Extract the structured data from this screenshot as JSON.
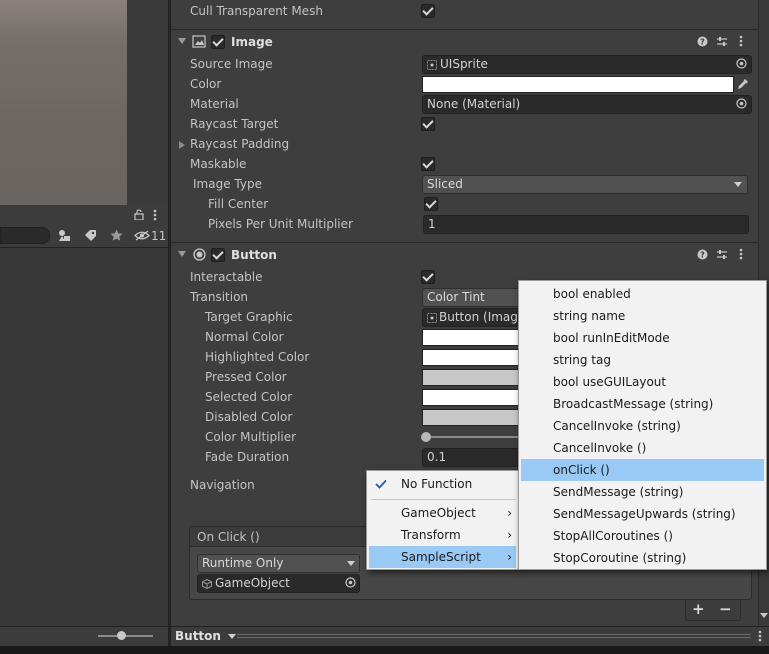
{
  "hierarchy": {
    "layer_count": "11"
  },
  "inspector": {
    "cull_transparent_mesh_label": "Cull Transparent Mesh",
    "image": {
      "title": "Image",
      "fields": {
        "source_image_label": "Source Image",
        "source_image_value": "UISprite",
        "color_label": "Color",
        "material_label": "Material",
        "material_value": "None (Material)",
        "raycast_target_label": "Raycast Target",
        "raycast_padding_label": "Raycast Padding",
        "maskable_label": "Maskable",
        "image_type_label": "Image Type",
        "image_type_value": "Sliced",
        "fill_center_label": "Fill Center",
        "ppu_label": "Pixels Per Unit Multiplier",
        "ppu_value": "1"
      }
    },
    "button": {
      "title": "Button",
      "fields": {
        "interactable_label": "Interactable",
        "transition_label": "Transition",
        "transition_value": "Color Tint",
        "target_graphic_label": "Target Graphic",
        "target_graphic_value": "Button (Image)",
        "normal_color_label": "Normal Color",
        "highlighted_color_label": "Highlighted Color",
        "pressed_color_label": "Pressed Color",
        "selected_color_label": "Selected Color",
        "disabled_color_label": "Disabled Color",
        "color_multiplier_label": "Color Multiplier",
        "fade_duration_label": "Fade Duration",
        "fade_duration_value": "0.1",
        "navigation_label": "Navigation"
      },
      "onclick": {
        "header": "On Click ()",
        "runtime_value": "Runtime Only",
        "object_value": "GameObject"
      }
    },
    "footer": {
      "add_label": "+",
      "remove_label": "−",
      "bottom_dropdown": "Button"
    }
  },
  "function_menu": {
    "items": [
      "No Function",
      "GameObject",
      "Transform",
      "SampleScript"
    ],
    "checked": "No Function",
    "highlighted": "SampleScript"
  },
  "method_menu": {
    "items": [
      "bool enabled",
      "string name",
      "bool runInEditMode",
      "string tag",
      "bool useGUILayout",
      "BroadcastMessage (string)",
      "CancelInvoke (string)",
      "CancelInvoke ()",
      "onClick ()",
      "SendMessage (string)",
      "SendMessageUpwards (string)",
      "StopAllCoroutines ()",
      "StopCoroutine (string)"
    ],
    "highlighted": "onClick ()"
  },
  "colors": {
    "selection": "#99c9f5",
    "menu_bg": "#f2f2f2",
    "inspector_bg": "#3e3e3e"
  }
}
